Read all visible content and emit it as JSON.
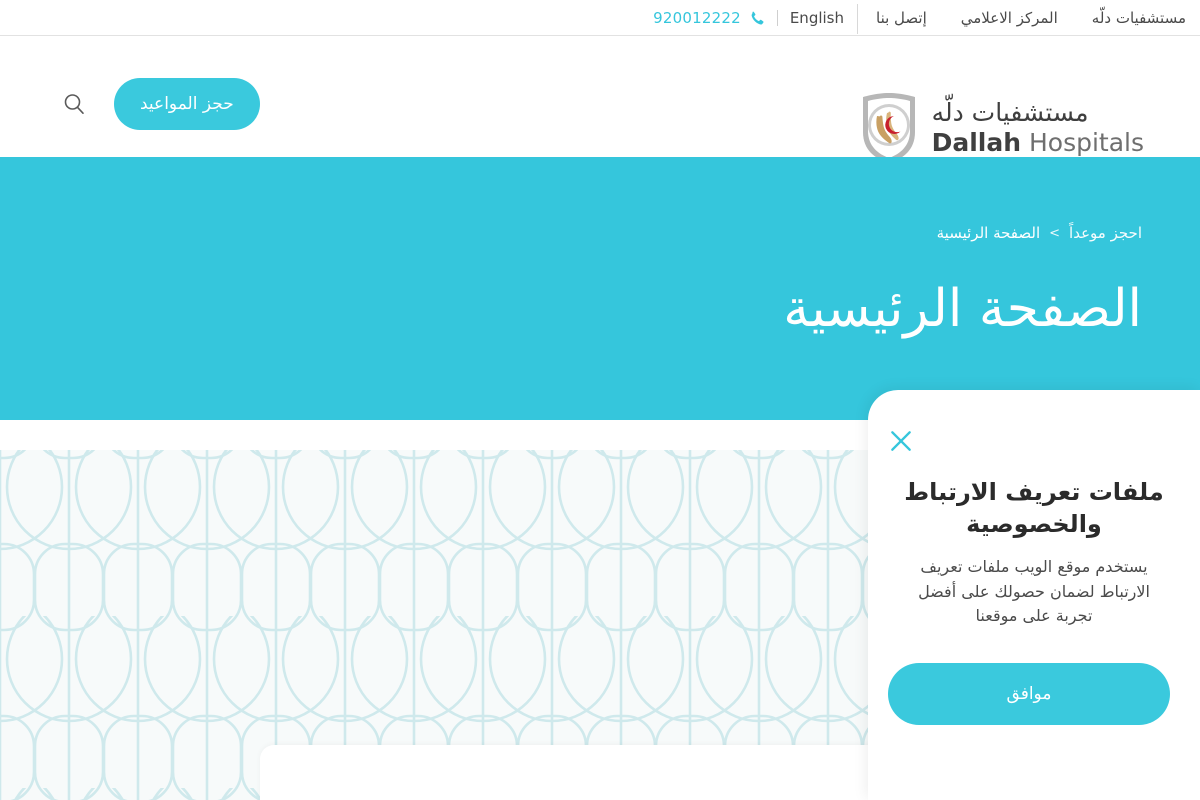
{
  "topbar": {
    "nav_links": [
      {
        "label": "مستشفيات دلّه",
        "name": "hospitals"
      },
      {
        "label": "المركز الاعلامي",
        "name": "media-center"
      },
      {
        "label": "إتصل بنا",
        "name": "contact-us"
      }
    ],
    "language_label": "English",
    "phone_number": "920012222",
    "phone_icon": "phone-icon"
  },
  "header": {
    "logo_arabic": "مستشفيات دلّه",
    "logo_english_bold": "Dallah",
    "logo_english_light": "Hospitals",
    "appointment_button": "حجز المواعيد",
    "search_icon": "search-icon"
  },
  "hero": {
    "breadcrumb": [
      {
        "label": "احجز موعداً",
        "name": "book-appointment"
      },
      {
        "label": "الصفحة الرئيسية",
        "name": "home"
      }
    ],
    "breadcrumb_separator": ">",
    "title": "الصفحة الرئيسية"
  },
  "cookie_consent": {
    "close_icon": "close-icon",
    "title": "ملفات تعريف الارتباط والخصوصية",
    "body": "يستخدم موقع الويب ملفات تعريف الارتباط لضمان حصولك على أفضل تجربة على موقعنا",
    "accept_button": "موافق"
  },
  "colors": {
    "brand_teal": "#35c6dc",
    "button_teal": "#3ac9dd",
    "pattern_line": "#cfe9ec",
    "pattern_bg": "#f7fafa",
    "text_dark": "#2b2b2b",
    "text_gray": "#4a4a4a",
    "logo_gold": "#c9a063",
    "logo_red": "#c8202e",
    "logo_shield": "#b5b5b5"
  }
}
